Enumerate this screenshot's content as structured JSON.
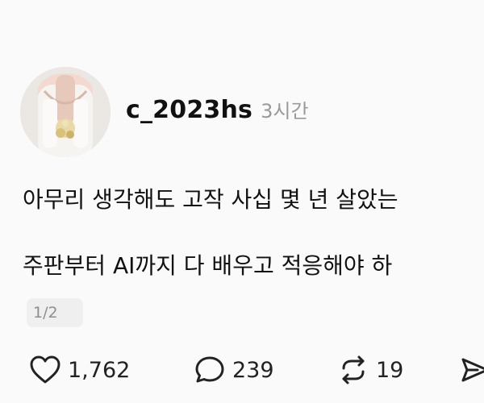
{
  "post": {
    "username": "c_2023hs",
    "time": "3시간",
    "text_lines": [
      "아무리 생각해도 고작 사십 몇 년 살았는",
      "주판부터 AI까지 다 배우고 적응해야 하"
    ],
    "page_indicator": "1/2"
  },
  "actions": {
    "likes": "1,762",
    "comments": "239",
    "reposts": "19"
  },
  "icons": {
    "like": "heart-icon",
    "comment": "comment-icon",
    "repost": "repost-icon",
    "share": "send-icon"
  },
  "colors": {
    "background": "#fafafa",
    "text": "#111111",
    "muted": "#9a9a9a"
  }
}
